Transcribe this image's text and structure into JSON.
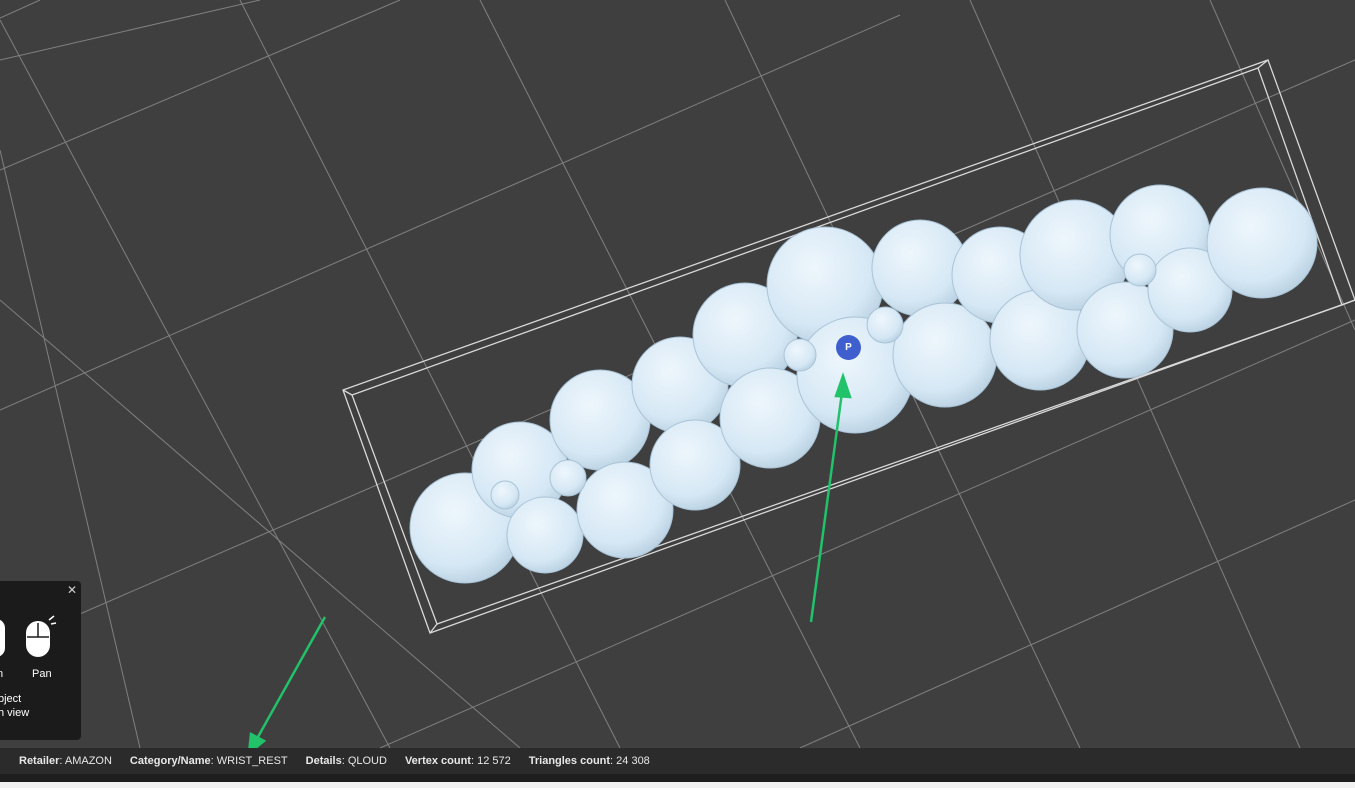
{
  "viewport": {
    "model_name": "WRIST_REST",
    "point_marker": "P",
    "colors": {
      "background": "#3f3f3f",
      "grid": "#8c8c8c",
      "bounding_box": "#d8d8d8",
      "model": "#d6e8f5",
      "annotation_arrow": "#22c26a",
      "marker": "#3f5fcf"
    }
  },
  "controls_panel": {
    "close_icon": "close-icon",
    "left_label": "n",
    "pan_label": "Pan",
    "hint_line1": "bject",
    "hint_line2": "h view"
  },
  "status_bar": {
    "lead": "'",
    "retailer_key": "Retailer",
    "retailer_value": ": AMAZON",
    "category_key": "Category/Name",
    "category_value": ": WRIST_REST",
    "details_key": "Details",
    "details_value": ": QLOUD",
    "vertex_key": "Vertex count",
    "vertex_value": ": 12 572",
    "triangles_key": "Triangles count",
    "triangles_value": ": 24 308"
  }
}
